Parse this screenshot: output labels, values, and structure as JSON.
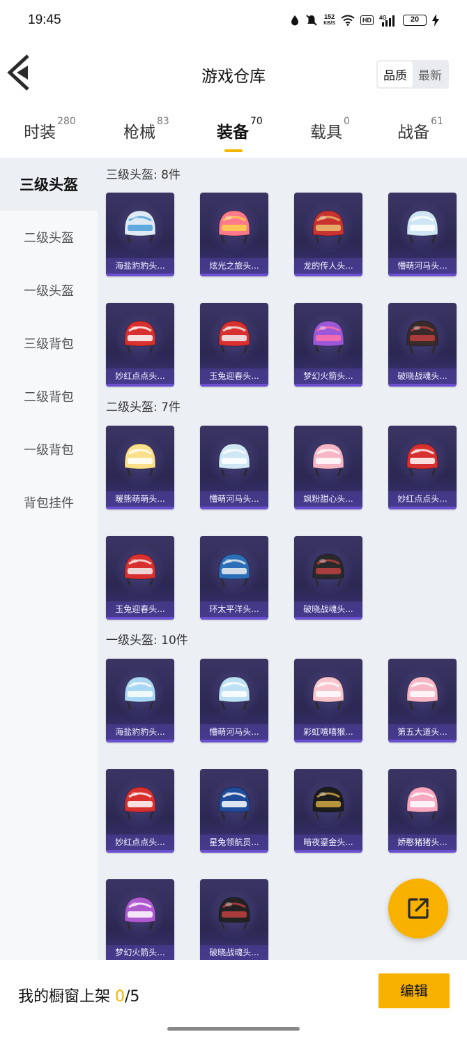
{
  "status_bar": {
    "time": "19:45",
    "net_speed_value": "152",
    "net_speed_unit": "KB/S",
    "hd": "HD",
    "network": "4G",
    "battery": "20"
  },
  "header": {
    "title": "游戏仓库",
    "sort_options": [
      "品质",
      "最新"
    ],
    "active_sort": "品质"
  },
  "category_tabs": [
    {
      "label": "时装",
      "count": "280"
    },
    {
      "label": "枪械",
      "count": "83"
    },
    {
      "label": "装备",
      "count": "70",
      "active": true
    },
    {
      "label": "载具",
      "count": "0"
    },
    {
      "label": "战备",
      "count": "61"
    }
  ],
  "sidebar": {
    "items": [
      "三级头盔",
      "二级头盔",
      "一级头盔",
      "三级背包",
      "二级背包",
      "一级背包",
      "背包挂件"
    ],
    "active": "三级头盔"
  },
  "sections": [
    {
      "title": "三级头盔: 8件",
      "items": [
        {
          "label": "海盐豹豹头...",
          "color": "#dfeaf5",
          "accent": "#4a9fd8"
        },
        {
          "label": "炫光之旅头...",
          "color": "#ff7a8a",
          "accent": "#ffd24a"
        },
        {
          "label": "龙的传人头...",
          "color": "#c9322f",
          "accent": "#e9c070"
        },
        {
          "label": "懵萌河马头...",
          "color": "#cfe6f4",
          "accent": "#ffffff"
        },
        {
          "label": "妙红点点头...",
          "color": "#d8302f",
          "accent": "#ffffff"
        },
        {
          "label": "玉兔迎春头...",
          "color": "#d8302f",
          "accent": "#f2f2f2"
        },
        {
          "label": "梦幻火箭头...",
          "color": "#9a57d8",
          "accent": "#ff6fa8"
        },
        {
          "label": "破晓战魂头...",
          "color": "#3a2a2a",
          "accent": "#c04040"
        }
      ]
    },
    {
      "title": "二级头盔: 7件",
      "items": [
        {
          "label": "暖熊萌萌头...",
          "color": "#fbe08a",
          "accent": "#ffffff"
        },
        {
          "label": "懵萌河马头...",
          "color": "#cfe6f4",
          "accent": "#ffffff"
        },
        {
          "label": "飒粉甜心头...",
          "color": "#f7b6c6",
          "accent": "#ffffff"
        },
        {
          "label": "妙红点点头...",
          "color": "#d8302f",
          "accent": "#ffffff"
        },
        {
          "label": "玉兔迎春头...",
          "color": "#d8302f",
          "accent": "#f2f2f2"
        },
        {
          "label": "环太平洋头...",
          "color": "#2a6fb8",
          "accent": "#f0f0f0"
        },
        {
          "label": "破晓战魂头...",
          "color": "#2a2a2a",
          "accent": "#c04040"
        }
      ]
    },
    {
      "title": "一级头盔: 10件",
      "items": [
        {
          "label": "海盐豹豹头...",
          "color": "#a9d6f2",
          "accent": "#ffffff"
        },
        {
          "label": "懵萌河马头...",
          "color": "#bde0f4",
          "accent": "#ffffff"
        },
        {
          "label": "彩虹嘻嘻猴...",
          "color": "#f9c4cc",
          "accent": "#ffffff"
        },
        {
          "label": "第五大道头...",
          "color": "#f7b6c6",
          "accent": "#ffffff"
        },
        {
          "label": "妙红点点头...",
          "color": "#d8302f",
          "accent": "#ffffff"
        },
        {
          "label": "星兔领航员...",
          "color": "#1f4b9a",
          "accent": "#ffffff"
        },
        {
          "label": "暗夜鎏金头...",
          "color": "#1c1c1c",
          "accent": "#d4a843"
        },
        {
          "label": "娇憨猪猪头...",
          "color": "#f7a8c0",
          "accent": "#ffffff"
        },
        {
          "label": "梦幻火箭头...",
          "color": "#b05ad0",
          "accent": "#ffffff"
        },
        {
          "label": "破晓战魂头...",
          "color": "#222222",
          "accent": "#c04040"
        }
      ]
    }
  ],
  "bottom_bar": {
    "label": "我的橱窗上架",
    "count": "0",
    "total": "/5",
    "edit_label": "编辑"
  }
}
